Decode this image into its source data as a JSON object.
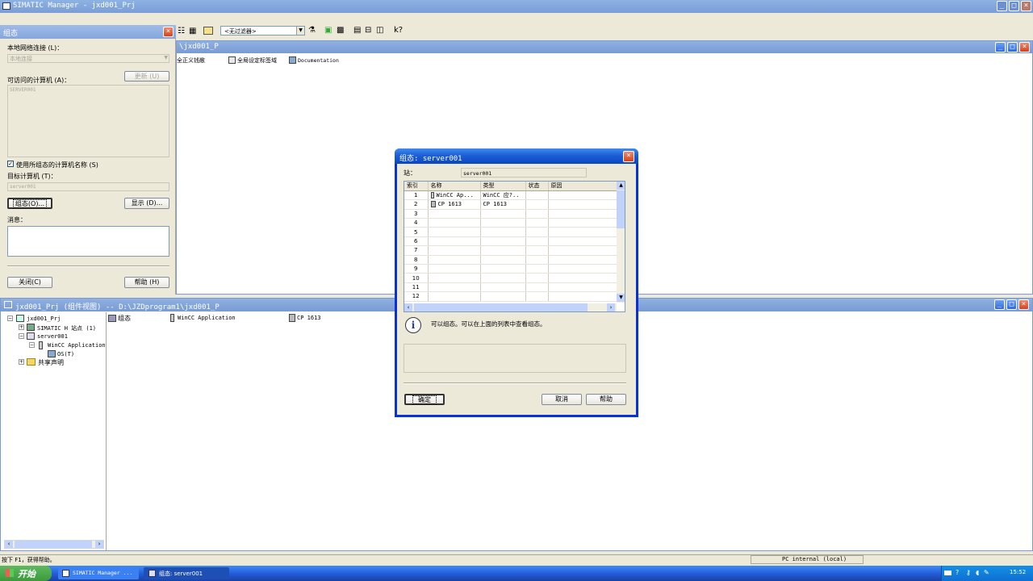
{
  "app": {
    "title": "SIMATIC Manager - jxd001_Prj"
  },
  "toolbar": {
    "filter_value": "<无过滤器>"
  },
  "left_panel": {
    "title": "组态",
    "network_label": "本地网络连接 (L)：",
    "network_value": "本地连接",
    "update_label": "更新 (U)",
    "computers_label": "可访问的计算机 (A)：",
    "computers_item": "SERVER001",
    "use_name_label": "使用所组态的计算机名称 (S)",
    "target_label": "目标计算机 (T)：",
    "target_value": "server001",
    "config_label": "组态(O)...",
    "display_label": "显示 (D)...",
    "message_label": "消息：",
    "close_label": "关闭(C)",
    "help_label": "帮助 (H)"
  },
  "doc_window": {
    "title": "\\jxd001_P",
    "items": [
      "全正义钱敝",
      "全局设定标签域",
      "Documentation"
    ]
  },
  "component_window": {
    "title": "jxd001_Prj (组件视图) -- D:\\JZDprogram1\\jxd001_P",
    "tree": [
      "jxd001_Prj",
      "SIMATIC H 站点 (1)",
      "server001",
      "WinCC Application",
      "OS(T)",
      "共享声明"
    ],
    "items": [
      "组态",
      "WinCC Application",
      "CP 1613"
    ]
  },
  "dialog": {
    "title": "组态: server001",
    "station_label": "站：",
    "station_value": "server001",
    "columns": [
      "索引",
      "名称",
      "类型",
      "状态",
      "原因"
    ],
    "rows": [
      [
        "1",
        "WinCC Ap...",
        "WinCC 应?..",
        "",
        ""
      ],
      [
        "2",
        "CP 1613",
        "CP 1613",
        "",
        ""
      ],
      [
        "3",
        "",
        "",
        "",
        ""
      ],
      [
        "4",
        "",
        "",
        "",
        ""
      ],
      [
        "5",
        "",
        "",
        "",
        ""
      ],
      [
        "6",
        "",
        "",
        "",
        ""
      ],
      [
        "7",
        "",
        "",
        "",
        ""
      ],
      [
        "8",
        "",
        "",
        "",
        ""
      ],
      [
        "9",
        "",
        "",
        "",
        ""
      ],
      [
        "10",
        "",
        "",
        "",
        ""
      ],
      [
        "11",
        "",
        "",
        "",
        ""
      ],
      [
        "12",
        "",
        "",
        "",
        ""
      ]
    ],
    "info_text": "可以组态。可以在上面的列表中查看组态。",
    "ok_label": "确定",
    "cancel_label": "取消",
    "help_label": "帮助"
  },
  "statusbar": {
    "hint": "按下 F1，获得帮助。",
    "mode": "PC internal (local)"
  },
  "taskbar": {
    "start_label": "开始",
    "tasks": [
      "SIMATIC Manager ...",
      "组态: server001"
    ],
    "clock": "15:52"
  },
  "colors": {
    "titlebar": "#0a47c2",
    "dialog_border": "#0831d9",
    "start": "#3c9a3c"
  }
}
